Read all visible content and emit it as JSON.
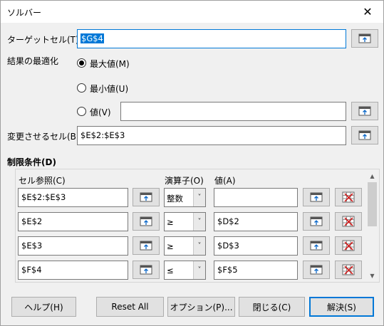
{
  "window": {
    "title": "ソルバー",
    "close_label": "✕"
  },
  "target": {
    "label": "ターゲットセル(T)",
    "value": "$G$4"
  },
  "optimize": {
    "label": "結果の最適化",
    "max_label": "最大値(M)",
    "min_label": "最小値(U)",
    "value_label": "値(V)",
    "value_field": "",
    "selected": "max"
  },
  "changing": {
    "label": "変更させるセル(B)",
    "value": "$E$2:$E$3"
  },
  "constraints": {
    "label": "制限条件(D)",
    "col_ref": "セル参照(C)",
    "col_op": "演算子(O)",
    "col_val": "値(A)",
    "rows": [
      {
        "ref": "$E$2:$E$3",
        "op": "整数",
        "val": ""
      },
      {
        "ref": "$E$2",
        "op": "≥",
        "val": "$D$2"
      },
      {
        "ref": "$E$3",
        "op": "≥",
        "val": "$D$3"
      },
      {
        "ref": "$F$4",
        "op": "≤",
        "val": "$F$5"
      }
    ]
  },
  "buttons": {
    "help": "ヘルプ(H)",
    "reset": "Reset All",
    "options": "オプション(P)...",
    "close": "閉じる(C)",
    "solve": "解決(S)"
  },
  "icons": {
    "shrink": "shrink-icon",
    "remove": "remove-icon",
    "accent": "#0078d7"
  }
}
